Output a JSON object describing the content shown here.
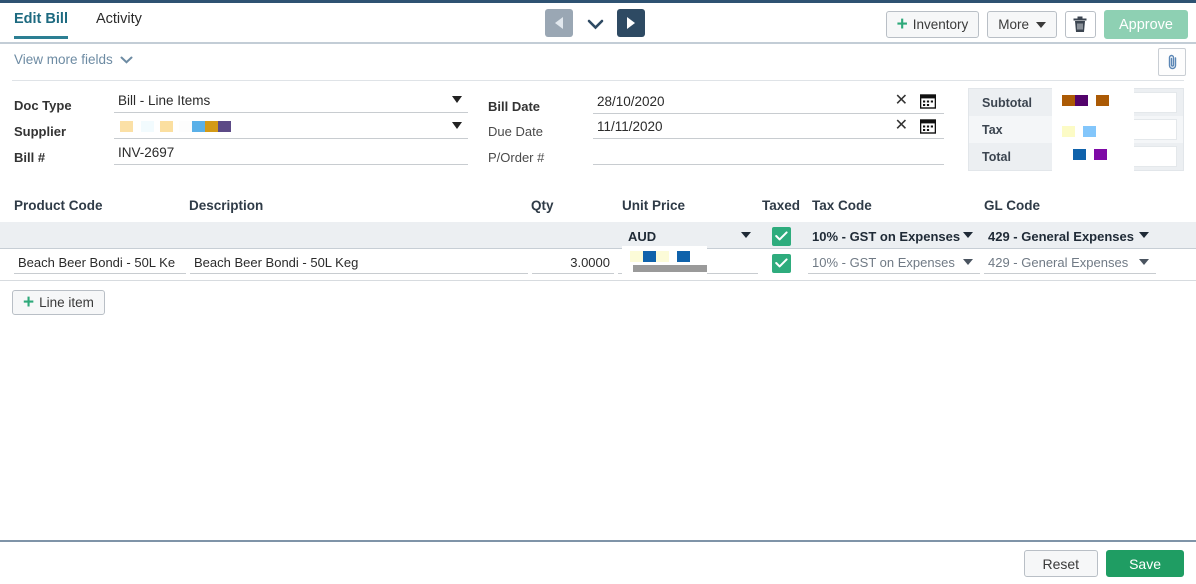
{
  "tabs": [
    {
      "label": "Edit Bill",
      "active": true
    },
    {
      "label": "Activity",
      "active": false
    }
  ],
  "toolbar": {
    "prev_icon": "triangle-left-icon",
    "next_icon": "triangle-right-icon",
    "expand_icon": "chevron-down-icon",
    "inventory_label": "Inventory",
    "more_label": "More",
    "delete_icon": "trash-icon",
    "approve_label": "Approve",
    "attachment_icon": "paperclip-icon"
  },
  "subheader": {
    "view_more_label": "View more fields"
  },
  "form": {
    "doc_type": {
      "label": "Doc Type",
      "value": "Bill - Line Items"
    },
    "supplier": {
      "label": "Supplier",
      "value": ""
    },
    "bill_number": {
      "label": "Bill #",
      "value": "INV-2697"
    },
    "bill_date": {
      "label": "Bill Date",
      "value": "28/10/2020"
    },
    "due_date": {
      "label": "Due Date",
      "value": "11/11/2020"
    },
    "purchase_order": {
      "label": "P/Order #",
      "value": ""
    }
  },
  "totals": {
    "subtotal_label": "Subtotal",
    "tax_label": "Tax",
    "total_label": "Total",
    "subtotal_value": "",
    "tax_value": "",
    "total_value": ""
  },
  "table": {
    "columns": {
      "product_code": "Product Code",
      "description": "Description",
      "qty": "Qty",
      "unit_price": "Unit Price",
      "taxed": "Taxed",
      "tax_code": "Tax Code",
      "gl_code": "GL Code"
    },
    "defaults_row": {
      "currency": "AUD",
      "tax_code": "10% - GST on Expenses",
      "gl_code": "429 - General Expenses"
    },
    "rows": [
      {
        "product_code": "Beach Beer Bondi - 50L Ke",
        "description": "Beach Beer Bondi - 50L Keg",
        "qty": "3.0000",
        "unit_price": "",
        "tax_code": "10% - GST on Expenses",
        "gl_code": "429 - General Expenses"
      }
    ],
    "add_line_label": "Line item",
    "row_menu_icon": "kebab-menu-icon"
  },
  "footer": {
    "reset_label": "Reset",
    "save_label": "Save"
  },
  "colors": {
    "accent": "#2c7f93",
    "nav_active": "#2e4a63",
    "nav_disabled": "#9aa7b4",
    "approve": "#8ed0b3",
    "save": "#1f9d63",
    "check": "#2eac7d",
    "rule": "#3e5f7e"
  }
}
